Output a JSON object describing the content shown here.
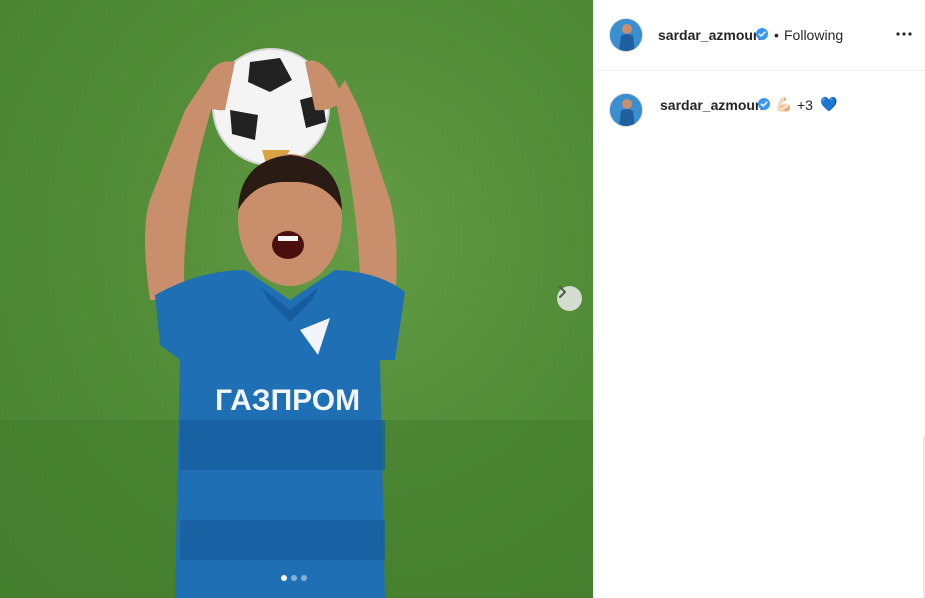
{
  "post": {
    "username": "sardar_azmoun",
    "follow_separator": "•",
    "follow_status": "Following",
    "more_icon": "more-options-icon",
    "verified_icon": "verified-badge-icon",
    "verified_color": "#3897f0"
  },
  "media": {
    "next_icon": "chevron-right-icon",
    "carousel_pages": 3,
    "current_page": 1,
    "shirt_text": "ГАЗПРОМ"
  },
  "caption": {
    "username": "sardar_azmoun",
    "emoji_1": "💪🏻",
    "text": "+3",
    "emoji_2": "💙"
  }
}
